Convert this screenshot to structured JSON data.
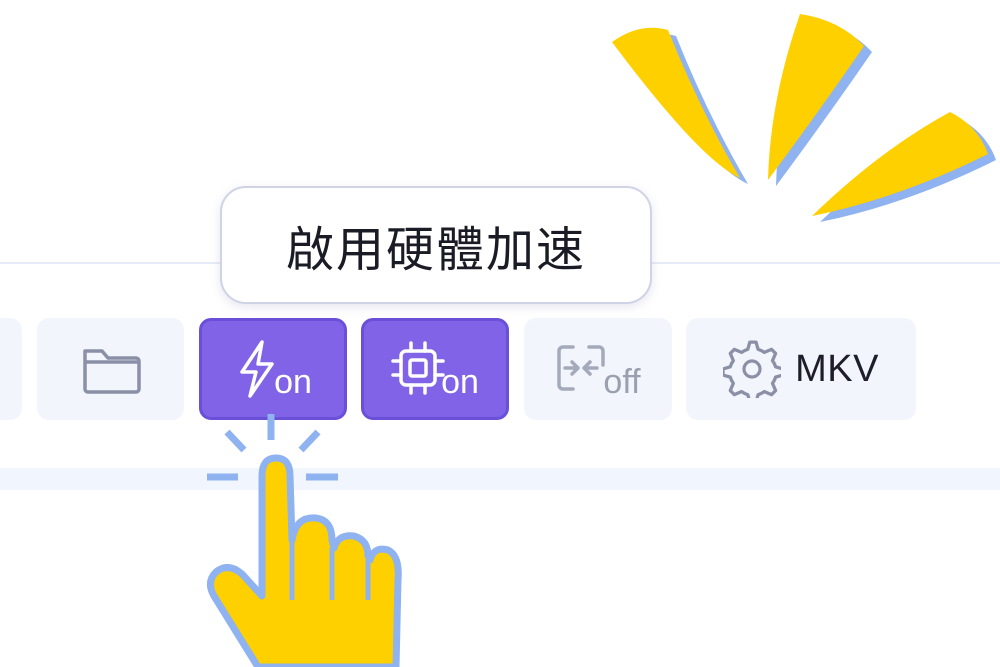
{
  "tooltip": {
    "text": "啟用硬體加速"
  },
  "toolbar": {
    "buttons": [
      {
        "name": "open-folder",
        "icon": "folder-icon"
      },
      {
        "name": "hardware-acceleration",
        "icon": "lightning-icon",
        "state": "on",
        "active": true
      },
      {
        "name": "gpu",
        "icon": "chip-icon",
        "state": "on",
        "active": true
      },
      {
        "name": "merge",
        "icon": "merge-icon",
        "state": "off",
        "active": false
      },
      {
        "name": "output-format",
        "icon": "gear-icon",
        "label": "MKV"
      }
    ]
  },
  "colors": {
    "accent": "#8063e6",
    "accent_border": "#6a4fd9",
    "button_bg": "#f2f5fc",
    "highlight_yellow": "#ffd000",
    "highlight_blue": "#8fb2f0"
  }
}
